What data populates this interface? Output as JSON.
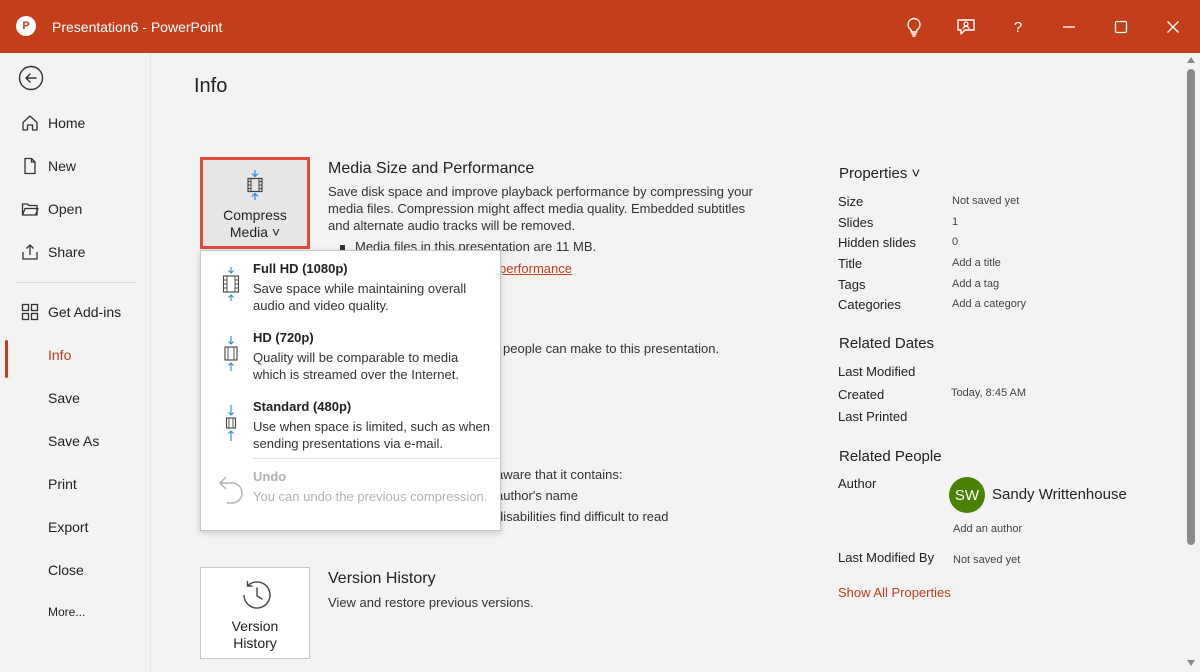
{
  "window": {
    "title": "Presentation6  -  PowerPoint",
    "logo_letter": "P",
    "help_label": "?"
  },
  "sidebar": {
    "items": [
      {
        "label": "Home",
        "icon": "home-icon"
      },
      {
        "label": "New",
        "icon": "new-file-icon"
      },
      {
        "label": "Open",
        "icon": "folder-icon"
      },
      {
        "label": "Share",
        "icon": "share-icon"
      },
      {
        "label": "Get Add-ins",
        "icon": "add-ins-icon"
      },
      {
        "label": "Info",
        "active": true
      },
      {
        "label": "Save"
      },
      {
        "label": "Save As"
      },
      {
        "label": "Print"
      },
      {
        "label": "Export"
      },
      {
        "label": "Close"
      },
      {
        "label": "More..."
      }
    ]
  },
  "main": {
    "title": "Info",
    "compress": {
      "button_line1": "Compress",
      "button_line2": "Media ˅",
      "heading": "Media Size and Performance",
      "desc": "Save disk space and improve playback performance by compressing your media files. Compression might affect media quality. Embedded subtitles and alternate audio tracks will be removed.",
      "bullet": "Media files in this presentation are 11 MB.",
      "link_partial": "performance"
    },
    "partial_texts": {
      "protect": "people can make to this presentation.",
      "inspect_line1": "aware that it contains:",
      "inspect_line2": "author's name",
      "inspect_line3": "disabilities find difficult to read"
    },
    "version": {
      "button_line1": "Version",
      "button_line2": "History",
      "heading": "Version History",
      "desc": "View and restore previous versions."
    }
  },
  "dropdown": {
    "items": [
      {
        "title": "Full HD (1080p)",
        "desc": "Save space while maintaining overall audio and video quality."
      },
      {
        "title": "HD (720p)",
        "desc": "Quality will be comparable to media which is streamed over the Internet."
      },
      {
        "title": "Standard (480p)",
        "desc": "Use when space is limited, such as when sending presentations via e-mail."
      },
      {
        "title": "Undo",
        "desc": "You can undo the previous compression.",
        "disabled": true
      }
    ]
  },
  "properties": {
    "heading": "Properties ˅",
    "rows": [
      {
        "label": "Size",
        "value": "Not saved yet"
      },
      {
        "label": "Slides",
        "value": "1"
      },
      {
        "label": "Hidden slides",
        "value": "0"
      },
      {
        "label": "Title",
        "value": "Add a title"
      },
      {
        "label": "Tags",
        "value": "Add a tag"
      },
      {
        "label": "Categories",
        "value": "Add a category"
      }
    ],
    "dates_heading": "Related Dates",
    "dates": [
      {
        "label": "Last Modified",
        "value": ""
      },
      {
        "label": "Created",
        "value": "Today, 8:45 AM"
      },
      {
        "label": "Last Printed",
        "value": ""
      }
    ],
    "people_heading": "Related People",
    "author_label": "Author",
    "author_initials": "SW",
    "author_name": "Sandy Writtenhouse",
    "add_author": "Add an author",
    "last_modified_by_label": "Last Modified By",
    "last_modified_by_value": "Not saved yet",
    "show_all": "Show All Properties"
  },
  "colors": {
    "accent": "#c43e1c",
    "highlight_border": "#e14c3d",
    "avatar": "#498205",
    "media_icon": "#2b88d8"
  }
}
